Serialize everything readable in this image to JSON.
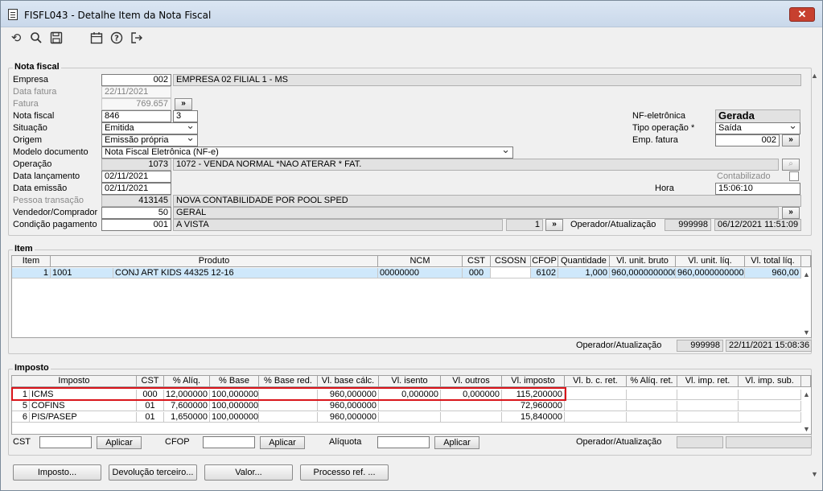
{
  "window": {
    "title": "FISFL043 - Detalhe Item da Nota Fiscal",
    "close": "✕"
  },
  "toolbar": {
    "icons": [
      "undo-icon",
      "search-icon",
      "save-icon",
      "calendar-icon",
      "help-icon",
      "exit-icon"
    ]
  },
  "nota": {
    "legend": "Nota fiscal",
    "empresa_lbl": "Empresa",
    "empresa_code": "002",
    "empresa_name": "EMPRESA 02 FILIAL 1 - MS",
    "data_fatura_lbl": "Data fatura",
    "data_fatura": "22/11/2021",
    "fatura_lbl": "Fatura",
    "fatura": "769.657",
    "fatura_btn": "»",
    "nota_lbl": "Nota fiscal",
    "nota_num": "846",
    "nota_serie": "3",
    "situacao_lbl": "Situação",
    "situacao": "Emitida",
    "origem_lbl": "Origem",
    "origem": "Emissão própria",
    "modelo_lbl": "Modelo documento",
    "modelo": "Nota Fiscal Eletrônica (NF-e)",
    "operacao_lbl": "Operação",
    "operacao_code": "1073",
    "operacao_desc": "1072 - VENDA NORMAL  *NAO ATERAR * FAT.",
    "data_lanc_lbl": "Data lançamento",
    "data_lanc": "02/11/2021",
    "data_emis_lbl": "Data emissão",
    "data_emis": "02/11/2021",
    "pessoa_lbl": "Pessoa transação",
    "pessoa_code": "413145",
    "pessoa_name": "NOVA CONTABILIDADE POR POOL SPED",
    "vendedor_lbl": "Vendedor/Comprador",
    "vendedor_code": "50",
    "vendedor_name": "GERAL",
    "vendedor_btn": "»",
    "condicao_lbl": "Condição pagamento",
    "condicao_code": "001",
    "condicao_name": "A VISTA",
    "condicao_num": "1",
    "condicao_btn": "»",
    "operador_lbl": "Operador/Atualização",
    "operador": "999998",
    "operador_date": "06/12/2021 11:51:09",
    "nfe_lbl": "NF-eletrônica",
    "nfe": "Gerada",
    "tipo_op_lbl": "Tipo operação *",
    "tipo_op": "Saída",
    "emp_fatura_lbl": "Emp. fatura",
    "emp_fatura": "002",
    "emp_fatura_btn": "»",
    "contabilizado_lbl": "Contabilizado",
    "hora_lbl": "Hora",
    "hora": "15:06:10",
    "op_search_btn": "⌕"
  },
  "item": {
    "legend": "Item",
    "headers": [
      "Item",
      "Produto",
      "NCM",
      "CST",
      "CSOSN",
      "CFOP",
      "Quantidade",
      "Vl. unit. bruto",
      "Vl. unit. líq.",
      "Vl. total líq."
    ],
    "row": [
      "1",
      "1001",
      "CONJ ART KIDS 44325 12-16",
      "00000000",
      "000",
      "",
      "6102",
      "1,000",
      "960,0000000000",
      "960,0000000000",
      "960,00"
    ],
    "operador_lbl": "Operador/Atualização",
    "operador": "999998",
    "operador_date": "22/11/2021 15:08:36"
  },
  "imposto": {
    "legend": "Imposto",
    "headers": [
      "Imposto",
      "CST",
      "% Alíq.",
      "% Base",
      "% Base red.",
      "Vl. base cálc.",
      "Vl. isento",
      "Vl. outros",
      "Vl. imposto",
      "Vl. b. c. ret.",
      "% Alíq. ret.",
      "Vl. imp. ret.",
      "Vl. imp. sub."
    ],
    "rows": [
      [
        "1",
        "ICMS",
        "000",
        "12,000000",
        "100,000000",
        "",
        "960,000000",
        "0,000000",
        "0,000000",
        "115,200000"
      ],
      [
        "5",
        "COFINS",
        "01",
        "7,600000",
        "100,000000",
        "",
        "960,000000",
        "",
        "",
        "72,960000"
      ],
      [
        "6",
        "PIS/PASEP",
        "01",
        "1,650000",
        "100,000000",
        "",
        "960,000000",
        "",
        "",
        "15,840000"
      ]
    ],
    "cst_lbl": "CST",
    "cfop_lbl": "CFOP",
    "aliquota_lbl": "Alíquota",
    "aplicar": "Aplicar",
    "operador_lbl": "Operador/Atualização"
  },
  "buttons": {
    "imposto": "Imposto...",
    "devolucao": "Devolução terceiro...",
    "valor": "Valor...",
    "processo": "Processo ref. ..."
  }
}
